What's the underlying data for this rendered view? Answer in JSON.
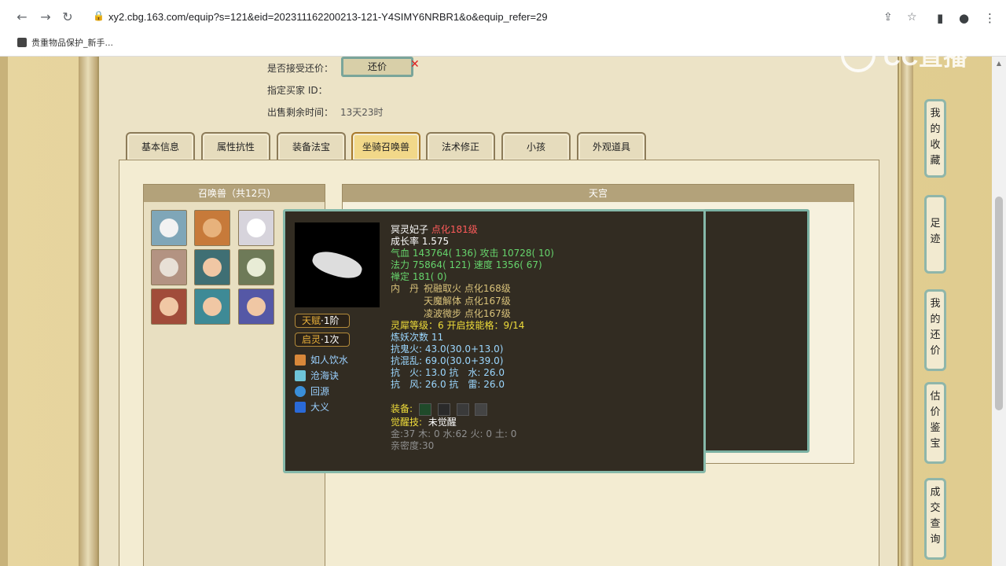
{
  "browser": {
    "url": "xy2.cbg.163.com/equip?s=121&eid=202311162200213-121-Y4SIMY6NRBR1&o&equip_refer=29",
    "bookmark": "贵重物品保护_新手..."
  },
  "watermark": "CC直播",
  "info": {
    "accept_counter_label": "是否接受还价：",
    "counter_button": "还价",
    "buyer_id_label": "指定买家 ID：",
    "remaining_label": "出售剩余时间：",
    "remaining_value": "13天23时"
  },
  "tabs": [
    "基本信息",
    "属性抗性",
    "装备法宝",
    "坐骑召唤兽",
    "法术修正",
    "小孩",
    "外观道具"
  ],
  "pet_panel": {
    "title": "召唤兽（共12只)"
  },
  "tiangong": {
    "title": "天宫"
  },
  "tooltip": {
    "name": "冥灵妃子",
    "level": "点化181级",
    "growth": "成长率 1.575",
    "hp": "气血 143764( 136) 攻击 10728( 10)",
    "mp": "法力 75864( 121) 速度 1356( 67)",
    "fixed": "禅定 181( 0)",
    "neidan_label": "内　丹",
    "neidan": [
      "祝融取火 点化168级",
      "天魔解体 点化167级",
      "凌波微步 点化167级"
    ],
    "lingxi": "灵犀等级：",
    "lingxi_value": "6 开启技能格：9/14",
    "lianyao": "炼妖次数 11",
    "kang_gui": "抗鬼火: 43.0(30.0+13.0)",
    "kang_hun": "抗混乱: 69.0(30.0+39.0)",
    "kang_fire": "抗　火: 13.0 抗　水: 26.0",
    "kang_wind": "抗　风: 26.0 抗　雷: 26.0",
    "equip_label": "装备:",
    "awaken_label": "觉醒技:",
    "awaken_value": "未觉醒",
    "elements": "金:37 木: 0 水:62 火: 0 土: 0",
    "intimacy": "亲密度:30",
    "badge1": "天赋",
    "badge1_value": "1阶",
    "badge2": "启灵",
    "badge2_value": "1次",
    "skills": [
      "如人饮水",
      "沧海诀",
      "回源",
      "大义"
    ]
  },
  "right_nav": [
    {
      "label": "我的收藏"
    },
    {
      "label": "足迹"
    },
    {
      "label": "我的还价"
    },
    {
      "label": "估价鉴宝"
    },
    {
      "label": "成交查询"
    }
  ],
  "colors": {
    "accent_teal": "#86b9aa",
    "tooltip_bg": "#322c22",
    "active_tab": "#f2d889"
  }
}
